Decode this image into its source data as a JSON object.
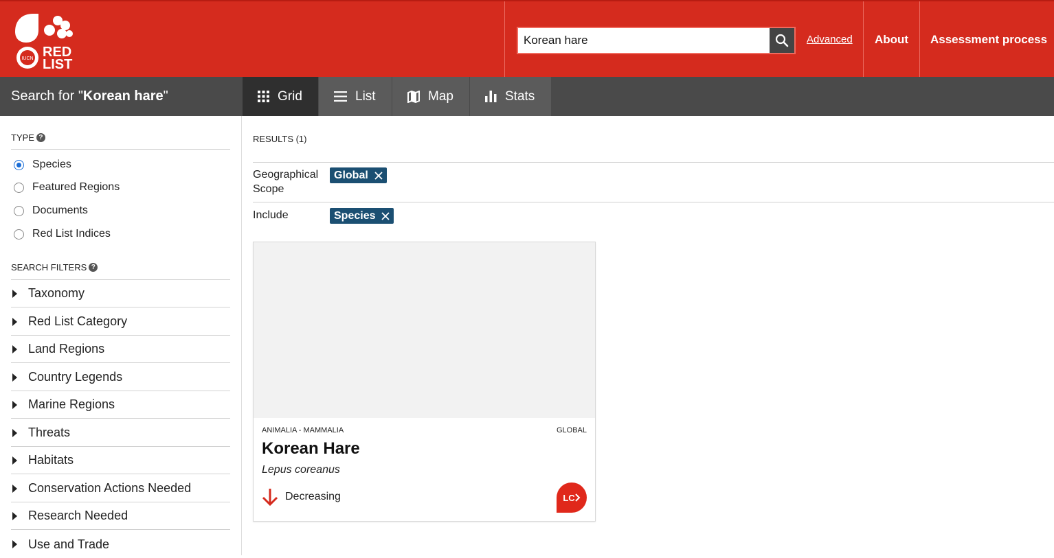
{
  "header": {
    "logo_text": "RED LIST",
    "search_value": "Korean hare",
    "advanced_label": "Advanced",
    "nav": [
      "About",
      "Assessment process"
    ]
  },
  "toolbar": {
    "search_prefix": "Search for \"",
    "search_query": "Korean hare",
    "search_suffix": "\"",
    "tabs": [
      "Grid",
      "List",
      "Map",
      "Stats"
    ],
    "active_tab": "Grid"
  },
  "sidebar": {
    "type_label": "TYPE",
    "type_options": [
      "Species",
      "Featured Regions",
      "Documents",
      "Red List Indices"
    ],
    "type_selected": "Species",
    "filters_label": "SEARCH FILTERS",
    "filters": [
      "Taxonomy",
      "Red List Category",
      "Land Regions",
      "Country Legends",
      "Marine Regions",
      "Threats",
      "Habitats",
      "Conservation Actions Needed",
      "Research Needed",
      "Use and Trade"
    ]
  },
  "main": {
    "results_label": "RESULTS (1)",
    "facets": [
      {
        "label": "Geographical Scope",
        "chip": "Global"
      },
      {
        "label": "Include",
        "chip": "Species"
      }
    ],
    "card": {
      "taxon": "ANIMALIA - MAMMALIA",
      "scope": "GLOBAL",
      "common_name": "Korean Hare",
      "scientific_name": "Lepus coreanus",
      "trend": "Decreasing",
      "category": "LC"
    }
  },
  "colors": {
    "brand_red": "#d52b1e",
    "toolbar": "#4a4a4a",
    "chip": "#1b4f72"
  }
}
